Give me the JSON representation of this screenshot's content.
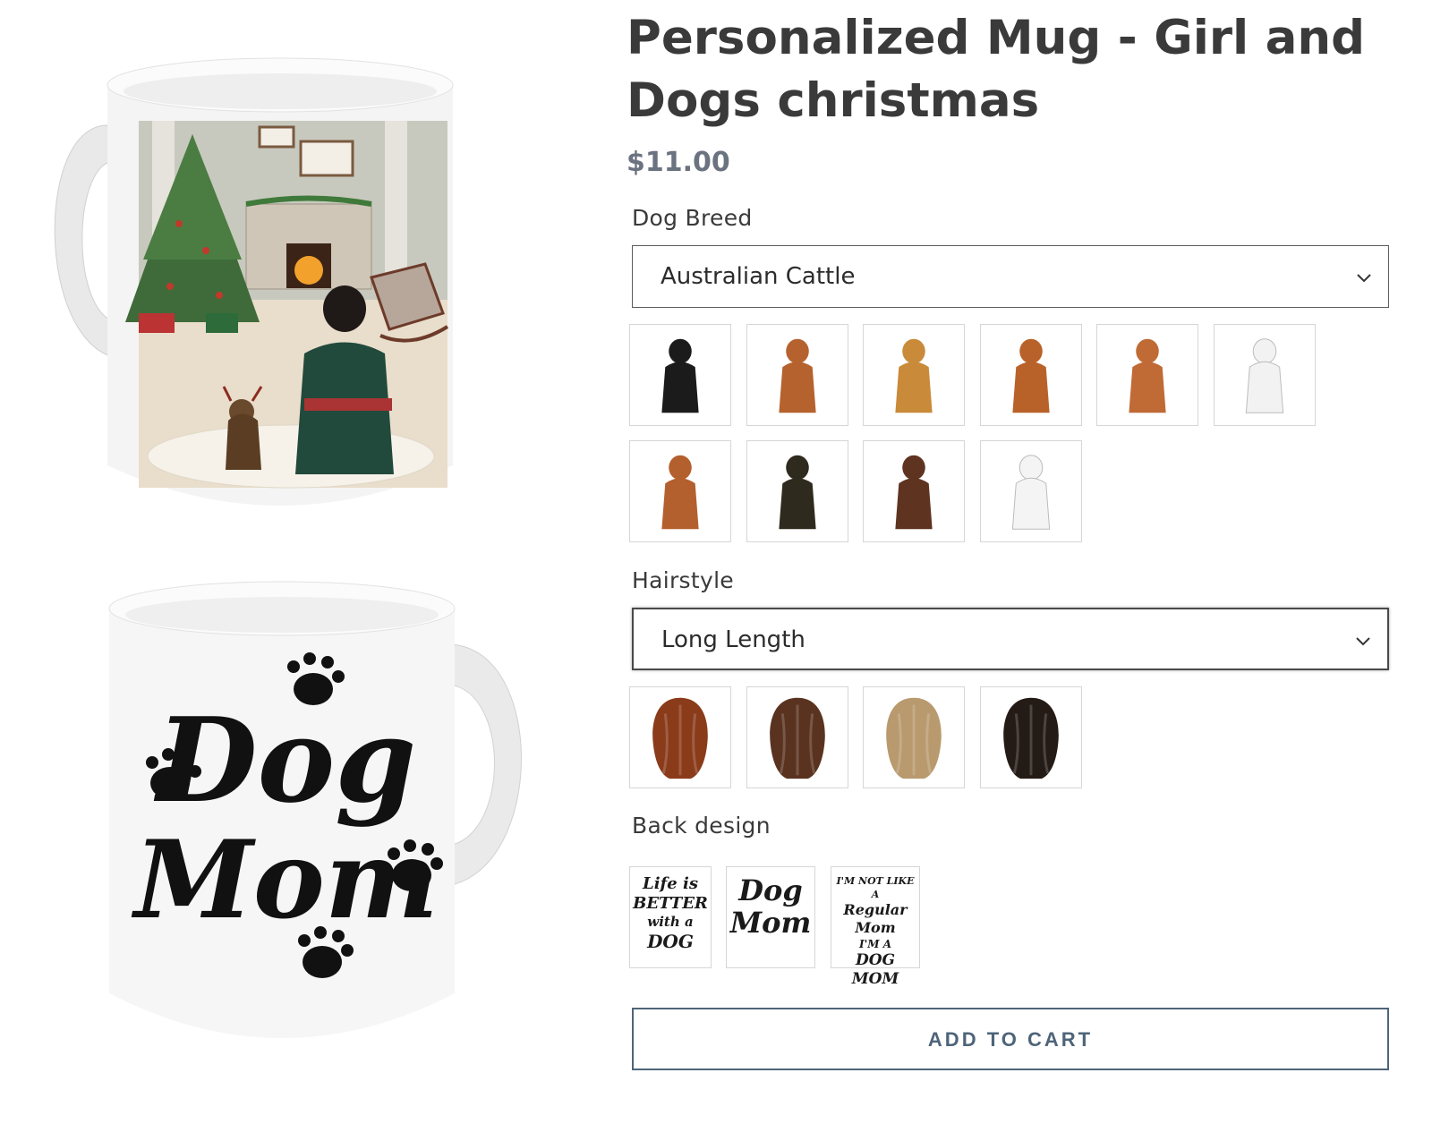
{
  "product": {
    "title": "Personalized Mug - Girl and Dogs christmas",
    "price": "$11.00"
  },
  "options": {
    "dog_breed": {
      "label": "Dog Breed",
      "selected": "Australian Cattle",
      "swatch_colors": [
        "#1b1b1b",
        "#b5622e",
        "#c98a3a",
        "#b8622a",
        "#c06a35",
        "#f2f2f2",
        "#b4602e",
        "#2f2a1e",
        "#5e3320",
        "#f4f4f4"
      ]
    },
    "hairstyle": {
      "label": "Hairstyle",
      "selected": "Long Length",
      "swatch_colors": [
        "#8a3b1a",
        "#5a3320",
        "#b99a6e",
        "#241b16"
      ]
    },
    "back_design": {
      "label": "Back design",
      "designs": [
        {
          "lines": [
            "Life is",
            "BETTER",
            "with a",
            "DOG"
          ]
        },
        {
          "lines": [
            "Dog",
            "Mom"
          ]
        },
        {
          "lines": [
            "I'M NOT LIKE A",
            "Regular Mom",
            "I'M A",
            "DOG MOM"
          ]
        }
      ]
    }
  },
  "cart": {
    "button_label": "ADD TO CART"
  },
  "mug_back_text": {
    "line1": "Dog",
    "line2": "Mom"
  },
  "colors": {
    "button_accent": "#4e6479",
    "text": "#3a3a3a",
    "price": "#6b7280"
  },
  "icons": {
    "select_arrow": "chevron-down-icon"
  }
}
